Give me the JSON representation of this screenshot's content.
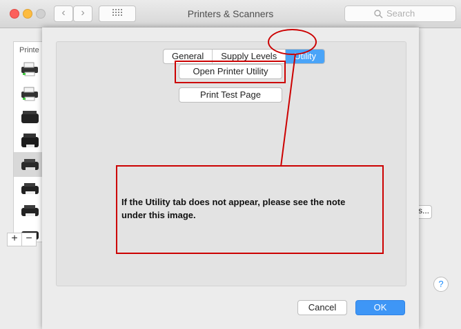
{
  "window": {
    "title": "Printers & Scanners",
    "search_placeholder": "Search"
  },
  "printer_list": {
    "header": "Printe",
    "add_label": "+",
    "remove_label": "−"
  },
  "hidden_button_label": "s...",
  "help_label": "?",
  "sheet": {
    "tabs": [
      {
        "label": "General"
      },
      {
        "label": "Supply Levels"
      },
      {
        "label": "Utility",
        "active": true
      }
    ],
    "open_utility_label": "Open Printer Utility",
    "print_test_label": "Print Test Page",
    "cancel_label": "Cancel",
    "ok_label": "OK"
  },
  "annotation": {
    "note": "If the Utility tab does not appear, please see the note under this image.",
    "color": "#cc0000"
  }
}
